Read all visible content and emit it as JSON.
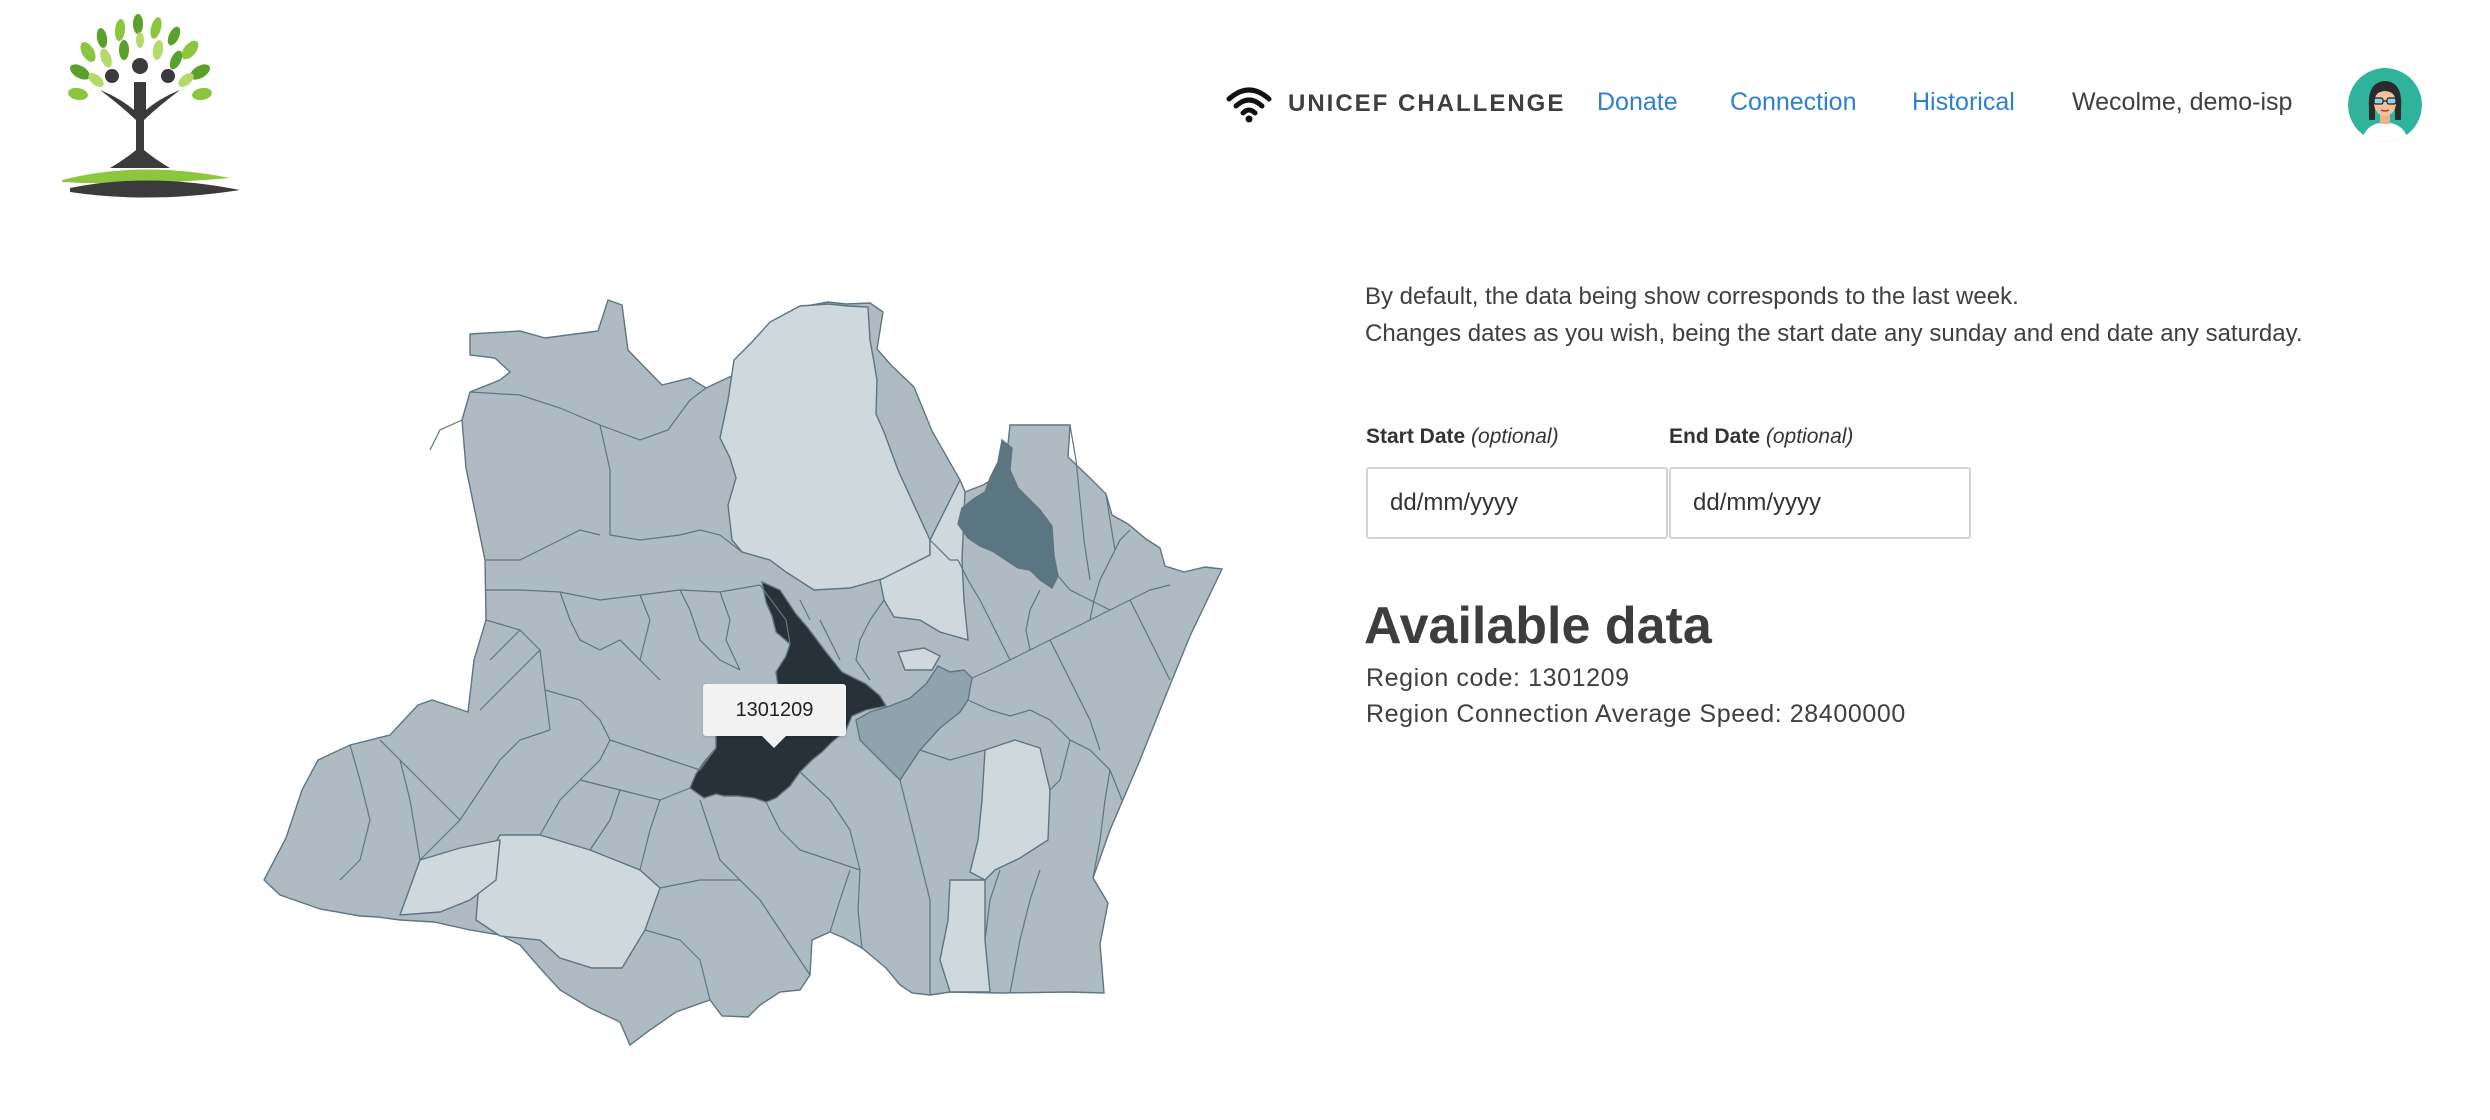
{
  "header": {
    "brand_name": "UNICEF CHALLENGE",
    "brand_icon": "wifi-icon",
    "logo_icon": "tree-logo-icon",
    "nav": {
      "donate": "Donate",
      "connection": "Connection",
      "historical": "Historical"
    },
    "welcome_text": "Wecolme, demo-isp",
    "avatar_icon": "user-avatar-icon"
  },
  "map": {
    "tooltip_text": "1301209",
    "colors": {
      "default": "#aebbc2",
      "light": "#ced8dd",
      "medium": "#8fa3ad",
      "dark": "#5b7581",
      "selected": "#263238",
      "border": "#5f7580"
    }
  },
  "description": {
    "line1": "By default, the data being show corresponds to the last week.",
    "line2": "Changes dates as you wish, being the start date any sunday and end date any saturday."
  },
  "filters": {
    "start_label": "Start Date",
    "start_optional": "(optional)",
    "start_placeholder": "dd/mm/yyyy",
    "end_label": "End Date",
    "end_optional": "(optional)",
    "end_placeholder": "dd/mm/yyyy"
  },
  "results": {
    "title": "Available data",
    "region_code_line": "Region code: 1301209",
    "speed_line": "Region Connection Average Speed: 28400000"
  },
  "theme": {
    "link_color": "#2f7fd1",
    "text_color": "#3f3f3f"
  }
}
